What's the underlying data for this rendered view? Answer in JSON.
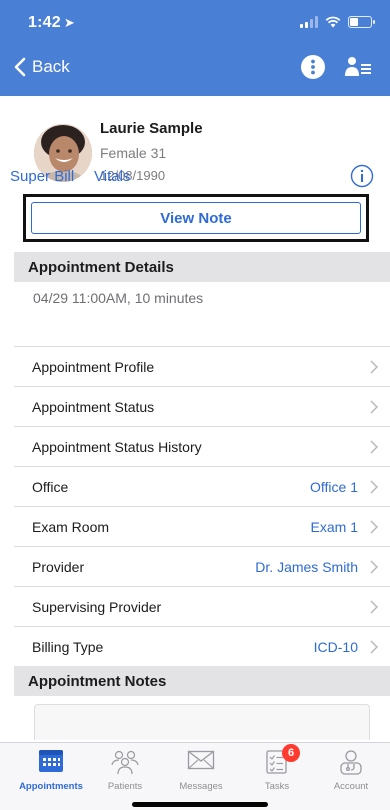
{
  "status_bar": {
    "time": "1:42",
    "signal_bars": 2,
    "battery_level": 0.4
  },
  "nav": {
    "back_label": "Back",
    "icons": [
      "more-vertical-icon",
      "patient-list-icon"
    ]
  },
  "patient": {
    "name": "Laurie Sample",
    "gender_age": "Female 31",
    "dob": "12/08/1990"
  },
  "links": {
    "super_bill": "Super Bill",
    "vitals": "Vitals"
  },
  "view_note_label": "View Note",
  "appointment_details": {
    "header": "Appointment Details",
    "summary": "04/29 11:00AM, 10 minutes",
    "rows": [
      {
        "label": "Appointment Profile",
        "value": ""
      },
      {
        "label": "Appointment Status",
        "value": ""
      },
      {
        "label": "Appointment Status History",
        "value": ""
      },
      {
        "label": "Office",
        "value": "Office 1"
      },
      {
        "label": "Exam Room",
        "value": "Exam 1"
      },
      {
        "label": "Provider",
        "value": "Dr. James Smith"
      },
      {
        "label": "Supervising Provider",
        "value": ""
      },
      {
        "label": "Billing Type",
        "value": "ICD-10"
      }
    ]
  },
  "appointment_notes": {
    "header": "Appointment Notes"
  },
  "tabbar": {
    "tabs": [
      {
        "label": "Appointments",
        "icon": "calendar-icon",
        "active": true
      },
      {
        "label": "Patients",
        "icon": "patients-icon",
        "active": false
      },
      {
        "label": "Messages",
        "icon": "envelope-icon",
        "active": false
      },
      {
        "label": "Tasks",
        "icon": "tasks-icon",
        "active": false,
        "badge": "6"
      },
      {
        "label": "Account",
        "icon": "account-icon",
        "active": false
      }
    ]
  },
  "colors": {
    "nav_blue": "#4a7fd6",
    "link_blue": "#2f6bd6",
    "badge_red": "#ff3b30",
    "section_gray": "#e3e3e6"
  }
}
